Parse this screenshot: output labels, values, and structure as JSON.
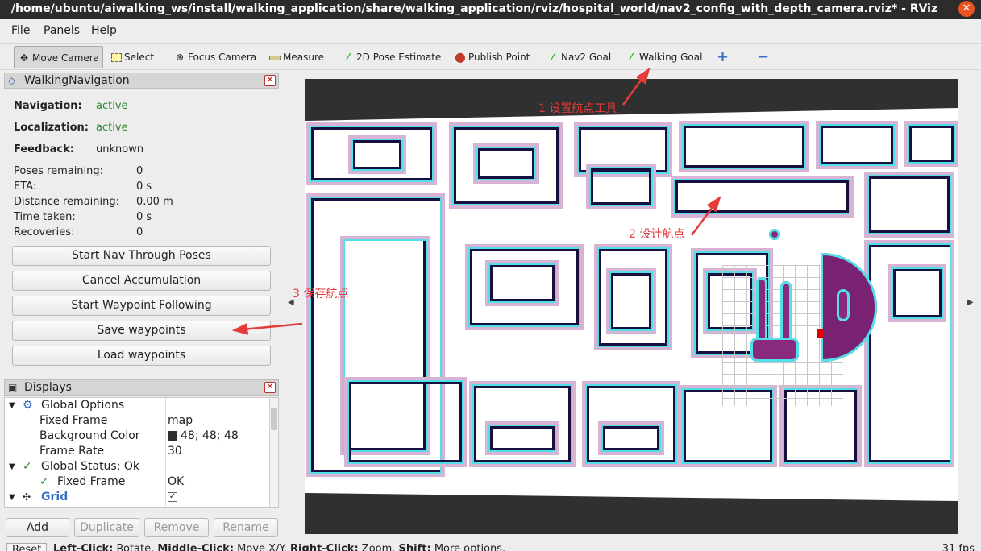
{
  "window": {
    "title": "/home/ubuntu/aiwalking_ws/install/walking_application/share/walking_application/rviz/hospital_world/nav2_config_with_depth_camera.rviz* - RViz",
    "close_glyph": "✕"
  },
  "menu": [
    "File",
    "Panels",
    "Help"
  ],
  "toolbar": {
    "tools": [
      {
        "label": "Move Camera",
        "icon": "move-camera-icon"
      },
      {
        "label": "Select",
        "icon": "select-icon"
      },
      {
        "label": "Focus Camera",
        "icon": "focus-camera-icon"
      },
      {
        "label": "Measure",
        "icon": "measure-icon"
      },
      {
        "label": "2D Pose Estimate",
        "icon": "pose-arrow-icon"
      },
      {
        "label": "Publish Point",
        "icon": "map-pin-icon"
      },
      {
        "label": "Nav2 Goal",
        "icon": "goal-arrow-icon"
      },
      {
        "label": "Walking Goal",
        "icon": "goal-arrow-icon"
      }
    ],
    "add_glyph": "+",
    "remove_glyph": "−"
  },
  "walking_panel": {
    "title": "WalkingNavigation",
    "status": [
      {
        "key": "Navigation:",
        "value": "active"
      },
      {
        "key": "Localization:",
        "value": "active"
      },
      {
        "key": "Feedback:",
        "value": "unknown"
      }
    ],
    "stats": [
      {
        "key": "Poses remaining:",
        "value": "0"
      },
      {
        "key": "ETA:",
        "value": "0 s"
      },
      {
        "key": "Distance remaining:",
        "value": "0.00 m"
      },
      {
        "key": "Time taken:",
        "value": "0 s"
      },
      {
        "key": "Recoveries:",
        "value": "0"
      }
    ],
    "buttons": [
      "Start Nav Through Poses",
      "Cancel Accumulation",
      "Start Waypoint Following",
      "Save waypoints",
      "Load waypoints"
    ]
  },
  "displays_panel": {
    "title": "Displays",
    "rows": [
      {
        "label": "Global Options",
        "value": ""
      },
      {
        "label": "Fixed Frame",
        "value": "map"
      },
      {
        "label": "Background Color",
        "value": "48; 48; 48"
      },
      {
        "label": "Frame Rate",
        "value": "30"
      },
      {
        "label": "Global Status: Ok",
        "value": ""
      },
      {
        "label": "Fixed Frame",
        "value": "OK"
      },
      {
        "label": "Grid",
        "value": ""
      }
    ],
    "buttons": [
      "Add",
      "Duplicate",
      "Remove",
      "Rename"
    ]
  },
  "statusbar": {
    "reset": "Reset",
    "hint_parts": [
      {
        "text": "Left-Click:",
        "bold": true
      },
      {
        "text": " Rotate. ",
        "bold": false
      },
      {
        "text": "Middle-Click:",
        "bold": true
      },
      {
        "text": " Move X/Y. ",
        "bold": false
      },
      {
        "text": "Right-Click:",
        "bold": true
      },
      {
        "text": " Zoom. ",
        "bold": false
      },
      {
        "text": "Shift:",
        "bold": true
      },
      {
        "text": " More options.",
        "bold": false
      }
    ],
    "fps": "31 fps"
  },
  "annotations": {
    "step1": "1 设置航点工具",
    "step2": "2 设计航点",
    "step3": "3 保存航点"
  },
  "colors": {
    "accent_close": "#e95420",
    "status_green": "#2e8b2e",
    "annotation_red": "#e53b3b",
    "viewport_bg": "#303030",
    "robot": "#e00000"
  }
}
